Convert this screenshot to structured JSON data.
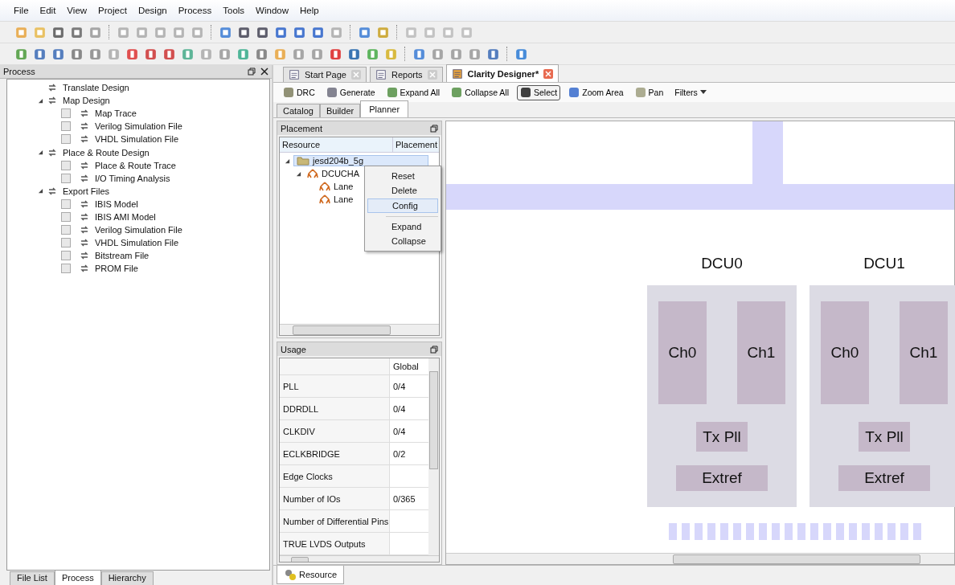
{
  "menu_bar": [
    "File",
    "Edit",
    "View",
    "Project",
    "Design",
    "Process",
    "Tools",
    "Window",
    "Help"
  ],
  "process_panel": {
    "title": "Process",
    "items": [
      {
        "label": "Translate Design"
      },
      {
        "label": "Map Design",
        "expanded": true,
        "children": [
          {
            "label": "Map Trace",
            "checked": false
          },
          {
            "label": "Verilog Simulation File",
            "checked": false
          },
          {
            "label": "VHDL Simulation File",
            "checked": false
          }
        ]
      },
      {
        "label": "Place & Route Design",
        "expanded": true,
        "children": [
          {
            "label": "Place & Route Trace",
            "checked": false
          },
          {
            "label": "I/O Timing Analysis",
            "checked": false
          }
        ]
      },
      {
        "label": "Export Files",
        "expanded": true,
        "children": [
          {
            "label": "IBIS Model",
            "checked": false
          },
          {
            "label": "IBIS AMI Model",
            "checked": false
          },
          {
            "label": "Verilog Simulation File",
            "checked": false
          },
          {
            "label": "VHDL Simulation File",
            "checked": false
          },
          {
            "label": "Bitstream File",
            "checked": false
          },
          {
            "label": "PROM File",
            "checked": false
          }
        ]
      }
    ]
  },
  "bottom_tabs": [
    {
      "label": "File List",
      "selected": false
    },
    {
      "label": "Process",
      "selected": true
    },
    {
      "label": "Hierarchy",
      "selected": false
    }
  ],
  "document_tabs": [
    {
      "label": "Start Page",
      "selected": false
    },
    {
      "label": "Reports",
      "selected": false
    },
    {
      "label": "Clarity Designer*",
      "selected": true
    }
  ],
  "designer_toolbar": [
    {
      "label": "DRC",
      "pressed": false
    },
    {
      "label": "Generate",
      "pressed": false
    },
    {
      "label": "Expand All",
      "pressed": false
    },
    {
      "label": "Collapse All",
      "pressed": false
    },
    {
      "label": "Select",
      "pressed": true
    },
    {
      "label": "Zoom Area",
      "pressed": false
    },
    {
      "label": "Pan",
      "pressed": false
    },
    {
      "label": "Filters",
      "pressed": false
    }
  ],
  "view_tabs": [
    {
      "label": "Catalog",
      "selected": false
    },
    {
      "label": "Builder",
      "selected": false
    },
    {
      "label": "Planner",
      "selected": true
    }
  ],
  "placement": {
    "title": "Placement",
    "columns": [
      "Resource",
      "Placement"
    ],
    "tree": [
      {
        "label": "jesd204b_5g",
        "selected": true,
        "expanded": true,
        "children": [
          {
            "label": "DCUCHA",
            "selected": false,
            "expanded": true,
            "children": [
              {
                "label": "Lane",
                "selected": false
              },
              {
                "label": "Lane",
                "selected": false
              }
            ]
          }
        ]
      }
    ]
  },
  "context_menu": {
    "groups": [
      [
        {
          "label": "Reset",
          "selected": false
        },
        {
          "label": "Delete",
          "selected": false
        },
        {
          "label": "Config",
          "selected": true
        }
      ],
      [
        {
          "label": "Expand",
          "selected": false
        },
        {
          "label": "Collapse",
          "selected": false
        }
      ]
    ]
  },
  "usage": {
    "title": "Usage",
    "columns": [
      "Global"
    ],
    "rows": [
      {
        "name": "PLL",
        "global": "0/4"
      },
      {
        "name": "DDRDLL",
        "global": "0/4"
      },
      {
        "name": "CLKDIV",
        "global": "0/4"
      },
      {
        "name": "ECLKBRIDGE",
        "global": "0/2"
      },
      {
        "name": "Edge Clocks"
      },
      {
        "name": "Number of IOs",
        "global": "0/365"
      },
      {
        "name": "Number of Differential Pins"
      },
      {
        "name": "TRUE LVDS Outputs"
      }
    ]
  },
  "resource_tab": {
    "label": "Resource"
  },
  "planner_canvas": {
    "dcus": [
      {
        "title": "DCU0",
        "channels": [
          "Ch0",
          "Ch1"
        ],
        "pll": "Tx Pll",
        "refclk": "Extref"
      },
      {
        "title": "DCU1",
        "channels": [
          "Ch0",
          "Ch1"
        ],
        "pll": "Tx Pll",
        "refclk": "Extref"
      }
    ]
  }
}
